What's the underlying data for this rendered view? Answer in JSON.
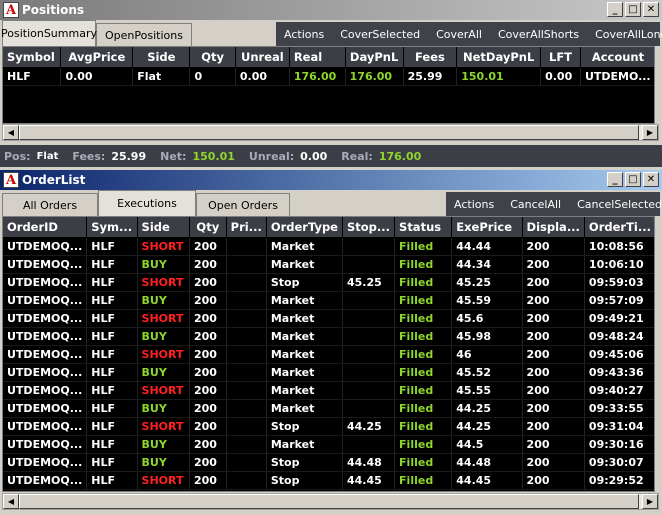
{
  "positions_window": {
    "title": "Positions",
    "tabs": [
      {
        "label": "PositionSummary"
      },
      {
        "label": "OpenPositions"
      }
    ],
    "actions": [
      "Actions",
      "CoverSelected",
      "CoverAll",
      "CoverAllShorts",
      "CoverAllLongs"
    ],
    "columns": [
      "Symbol",
      "AvgPrice",
      "Side",
      "Qty",
      "Unreal",
      "Real",
      "DayPnL",
      "Fees",
      "NetDayPnL",
      "LFT",
      "Account"
    ],
    "rows": [
      {
        "symbol": "HLF",
        "avg_price": "0.00",
        "side": "Flat",
        "qty": "0",
        "unreal": "0.00",
        "real": "176.00",
        "day_pnl": "176.00",
        "fees": "25.99",
        "net_day_pnl": "150.01",
        "lft": "0.00",
        "account": "UTDEMO..."
      }
    ],
    "status": {
      "pos_label": "Pos:",
      "pos_value": "Flat",
      "fees_label": "Fees:",
      "fees_value": "25.99",
      "net_label": "Net:",
      "net_value": "150.01",
      "unreal_label": "Unreal:",
      "unreal_value": "0.00",
      "real_label": "Real:",
      "real_value": "176.00"
    }
  },
  "orders_window": {
    "title": "OrderList",
    "tabs": [
      {
        "label": "All Orders"
      },
      {
        "label": "Executions"
      },
      {
        "label": "Open Orders"
      }
    ],
    "actions": [
      "Actions",
      "CancelAll",
      "CancelSelected"
    ],
    "columns": [
      "OrderID",
      "Sym...",
      "Side",
      "Qty",
      "Pri...",
      "OrderType",
      "Stop...",
      "Status",
      "ExePrice",
      "Displa...",
      "OrderTi..."
    ],
    "rows": [
      {
        "id": "UTDEMOQ...",
        "sym": "HLF",
        "side": "SHORT",
        "qty": "200",
        "price": "",
        "type": "Market",
        "stop": "",
        "status": "Filled",
        "exe": "44.44",
        "disp": "200",
        "time": "10:08:56"
      },
      {
        "id": "UTDEMOQ...",
        "sym": "HLF",
        "side": "BUY",
        "qty": "200",
        "price": "",
        "type": "Market",
        "stop": "",
        "status": "Filled",
        "exe": "44.34",
        "disp": "200",
        "time": "10:06:10"
      },
      {
        "id": "UTDEMOQ...",
        "sym": "HLF",
        "side": "SHORT",
        "qty": "200",
        "price": "",
        "type": "Stop",
        "stop": "45.25",
        "status": "Filled",
        "exe": "45.25",
        "disp": "200",
        "time": "09:59:03"
      },
      {
        "id": "UTDEMOQ...",
        "sym": "HLF",
        "side": "BUY",
        "qty": "200",
        "price": "",
        "type": "Market",
        "stop": "",
        "status": "Filled",
        "exe": "45.59",
        "disp": "200",
        "time": "09:57:09"
      },
      {
        "id": "UTDEMOQ...",
        "sym": "HLF",
        "side": "SHORT",
        "qty": "200",
        "price": "",
        "type": "Market",
        "stop": "",
        "status": "Filled",
        "exe": "45.6",
        "disp": "200",
        "time": "09:49:21"
      },
      {
        "id": "UTDEMOQ...",
        "sym": "HLF",
        "side": "BUY",
        "qty": "200",
        "price": "",
        "type": "Market",
        "stop": "",
        "status": "Filled",
        "exe": "45.98",
        "disp": "200",
        "time": "09:48:24"
      },
      {
        "id": "UTDEMOQ...",
        "sym": "HLF",
        "side": "SHORT",
        "qty": "200",
        "price": "",
        "type": "Market",
        "stop": "",
        "status": "Filled",
        "exe": "46",
        "disp": "200",
        "time": "09:45:06"
      },
      {
        "id": "UTDEMOQ...",
        "sym": "HLF",
        "side": "BUY",
        "qty": "200",
        "price": "",
        "type": "Market",
        "stop": "",
        "status": "Filled",
        "exe": "45.52",
        "disp": "200",
        "time": "09:43:36"
      },
      {
        "id": "UTDEMOQ...",
        "sym": "HLF",
        "side": "SHORT",
        "qty": "200",
        "price": "",
        "type": "Market",
        "stop": "",
        "status": "Filled",
        "exe": "45.55",
        "disp": "200",
        "time": "09:40:27"
      },
      {
        "id": "UTDEMOQ...",
        "sym": "HLF",
        "side": "BUY",
        "qty": "200",
        "price": "",
        "type": "Market",
        "stop": "",
        "status": "Filled",
        "exe": "44.25",
        "disp": "200",
        "time": "09:33:55"
      },
      {
        "id": "UTDEMOQ...",
        "sym": "HLF",
        "side": "SHORT",
        "qty": "200",
        "price": "",
        "type": "Stop",
        "stop": "44.25",
        "status": "Filled",
        "exe": "44.25",
        "disp": "200",
        "time": "09:31:04"
      },
      {
        "id": "UTDEMOQ...",
        "sym": "HLF",
        "side": "BUY",
        "qty": "200",
        "price": "",
        "type": "Market",
        "stop": "",
        "status": "Filled",
        "exe": "44.5",
        "disp": "200",
        "time": "09:30:16"
      },
      {
        "id": "UTDEMOQ...",
        "sym": "HLF",
        "side": "BUY",
        "qty": "200",
        "price": "",
        "type": "Stop",
        "stop": "44.48",
        "status": "Filled",
        "exe": "44.48",
        "disp": "200",
        "time": "09:30:07"
      },
      {
        "id": "UTDEMOQ...",
        "sym": "HLF",
        "side": "SHORT",
        "qty": "200",
        "price": "",
        "type": "Stop",
        "stop": "44.45",
        "status": "Filled",
        "exe": "44.45",
        "disp": "200",
        "time": "09:29:52"
      }
    ]
  },
  "colors": {
    "buy": "#8ed62b",
    "short": "#ff2020",
    "filled": "#8ed62b",
    "header_bg": "#3c3e46",
    "grid_bg": "#000000"
  },
  "icons": {
    "app": "letter-a-logo",
    "minimize": "minimize-icon",
    "maximize": "maximize-icon",
    "close": "close-icon"
  }
}
